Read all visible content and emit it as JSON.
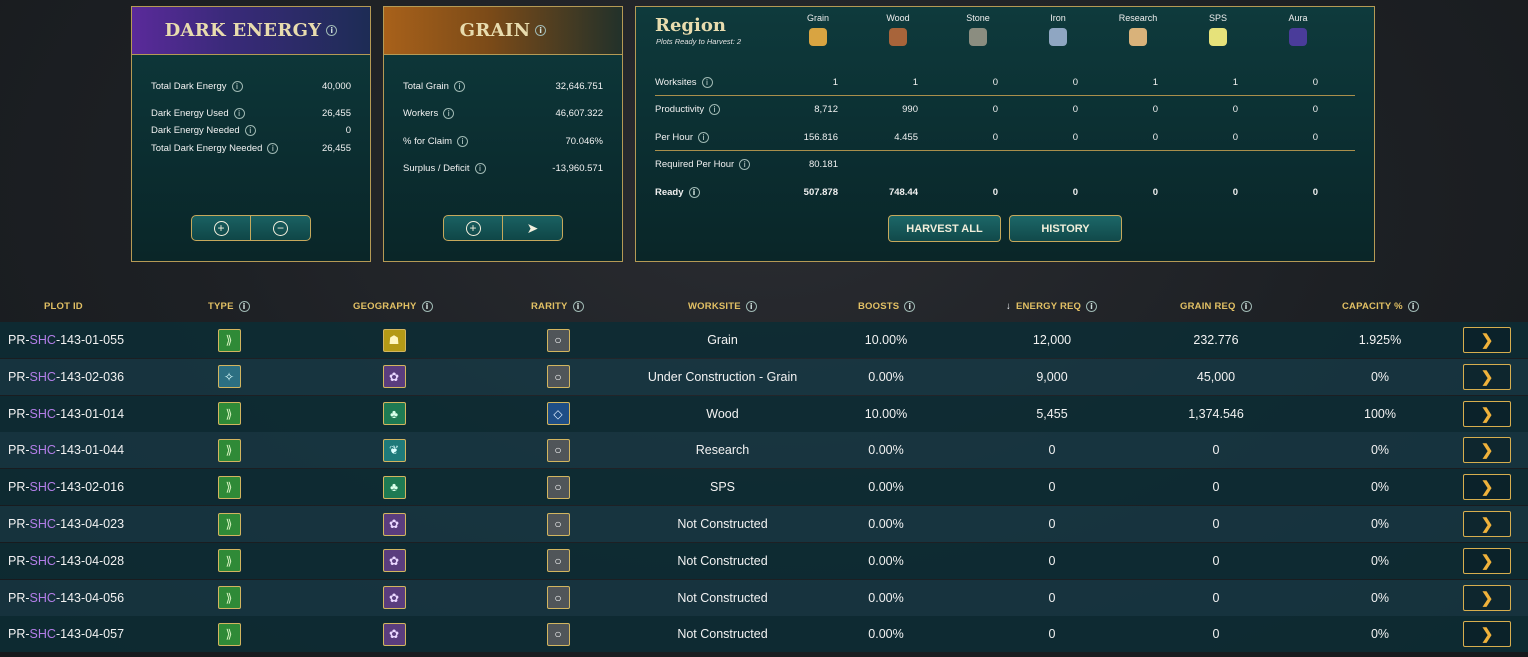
{
  "dark_energy": {
    "title": "DARK ENERGY",
    "stats": [
      {
        "label": "Total Dark Energy",
        "value": "40,000"
      },
      {
        "label": "Dark Energy Used",
        "value": "26,455"
      },
      {
        "label": "Dark Energy Needed",
        "value": "0"
      },
      {
        "label": "Total Dark Energy Needed",
        "value": "26,455"
      }
    ],
    "buttons": [
      "+",
      "−"
    ]
  },
  "grain": {
    "title": "GRAIN",
    "stats": [
      {
        "label": "Total Grain",
        "value": "32,646.751"
      },
      {
        "label": "Workers",
        "value": "46,607.322"
      },
      {
        "label": "% for Claim",
        "value": "70.046%"
      },
      {
        "label": "Surplus / Deficit",
        "value": "-13,960.571"
      }
    ],
    "buttons": [
      "+",
      "➤"
    ]
  },
  "region": {
    "title": "Region",
    "subtitle": "Plots Ready to Harvest: 2",
    "resources": [
      {
        "name": "Grain",
        "icon": "grain-icon",
        "color": "#d9a441"
      },
      {
        "name": "Wood",
        "icon": "wood-icon",
        "color": "#a8643a"
      },
      {
        "name": "Stone",
        "icon": "stone-icon",
        "color": "#8b8d80"
      },
      {
        "name": "Iron",
        "icon": "iron-icon",
        "color": "#8fa6c2"
      },
      {
        "name": "Research",
        "icon": "research-icon",
        "color": "#d9b27a"
      },
      {
        "name": "SPS",
        "icon": "sps-icon",
        "color": "#e6e27a"
      },
      {
        "name": "Aura",
        "icon": "aura-icon",
        "color": "#4a3c9a"
      }
    ],
    "rows": [
      {
        "label": "Worksites",
        "values": [
          "1",
          "1",
          "0",
          "0",
          "1",
          "1",
          "0"
        ]
      },
      {
        "label": "Productivity",
        "values": [
          "8,712",
          "990",
          "0",
          "0",
          "0",
          "0",
          "0"
        ]
      },
      {
        "label": "Per Hour",
        "values": [
          "156.816",
          "4.455",
          "0",
          "0",
          "0",
          "0",
          "0"
        ]
      },
      {
        "label": "Required Per Hour",
        "values": [
          "80.181",
          "",
          "",
          "",
          "",
          "",
          ""
        ]
      },
      {
        "label": "Ready",
        "values": [
          "507.878",
          "748.44",
          "0",
          "0",
          "0",
          "0",
          "0"
        ]
      }
    ],
    "harvest_all": "HARVEST ALL",
    "history": "HISTORY"
  },
  "table": {
    "headers": {
      "plot_id": "PLOT ID",
      "type": "TYPE",
      "geography": "GEOGRAPHY",
      "rarity": "RARITY",
      "worksite": "WORKSITE",
      "boosts": "BOOSTS",
      "energy_req": "ENERGY REQ",
      "grain_req": "GRAIN REQ",
      "capacity": "CAPACITY %"
    },
    "sort_arrow": "↓",
    "rows": [
      {
        "prefix": "PR-",
        "code": "SHC",
        "suffix": "-143-01-055",
        "type": "standard",
        "geo": "grain",
        "rarity": "common",
        "worksite": "Grain",
        "boosts": "10.00%",
        "energy": "12,000",
        "grain": "232.776",
        "capacity": "1.925%"
      },
      {
        "prefix": "PR-",
        "code": "SHC",
        "suffix": "-143-02-036",
        "type": "special",
        "geo": "purple",
        "rarity": "common",
        "worksite": "Under Construction - Grain",
        "boosts": "0.00%",
        "energy": "9,000",
        "grain": "45,000",
        "capacity": "0%"
      },
      {
        "prefix": "PR-",
        "code": "SHC",
        "suffix": "-143-01-014",
        "type": "standard",
        "geo": "green",
        "rarity": "rare",
        "worksite": "Wood",
        "boosts": "10.00%",
        "energy": "5,455",
        "grain": "1,374.546",
        "capacity": "100%"
      },
      {
        "prefix": "PR-",
        "code": "SHC",
        "suffix": "-143-01-044",
        "type": "standard",
        "geo": "teal",
        "rarity": "common",
        "worksite": "Research",
        "boosts": "0.00%",
        "energy": "0",
        "grain": "0",
        "capacity": "0%"
      },
      {
        "prefix": "PR-",
        "code": "SHC",
        "suffix": "-143-02-016",
        "type": "standard",
        "geo": "green",
        "rarity": "common",
        "worksite": "SPS",
        "boosts": "0.00%",
        "energy": "0",
        "grain": "0",
        "capacity": "0%"
      },
      {
        "prefix": "PR-",
        "code": "SHC",
        "suffix": "-143-04-023",
        "type": "standard",
        "geo": "purple",
        "rarity": "common",
        "worksite": "Not Constructed",
        "boosts": "0.00%",
        "energy": "0",
        "grain": "0",
        "capacity": "0%"
      },
      {
        "prefix": "PR-",
        "code": "SHC",
        "suffix": "-143-04-028",
        "type": "standard",
        "geo": "purple",
        "rarity": "common",
        "worksite": "Not Constructed",
        "boosts": "0.00%",
        "energy": "0",
        "grain": "0",
        "capacity": "0%"
      },
      {
        "prefix": "PR-",
        "code": "SHC",
        "suffix": "-143-04-056",
        "type": "standard",
        "geo": "purple",
        "rarity": "common",
        "worksite": "Not Constructed",
        "boosts": "0.00%",
        "energy": "0",
        "grain": "0",
        "capacity": "0%"
      },
      {
        "prefix": "PR-",
        "code": "SHC",
        "suffix": "-143-04-057",
        "type": "standard",
        "geo": "purple",
        "rarity": "common",
        "worksite": "Not Constructed",
        "boosts": "0.00%",
        "energy": "0",
        "grain": "0",
        "capacity": "0%"
      }
    ]
  }
}
